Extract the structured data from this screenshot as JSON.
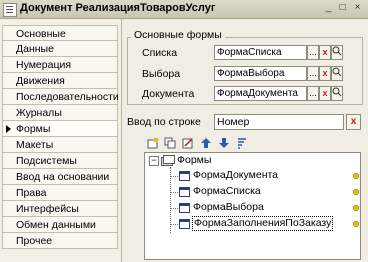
{
  "window": {
    "title": "Документ РеализацияТоваровУслуг"
  },
  "nav": {
    "items": [
      "Основные",
      "Данные",
      "Нумерация",
      "Движения",
      "Последовательности",
      "Журналы",
      "Формы",
      "Макеты",
      "Подсистемы",
      "Ввод на основании",
      "Права",
      "Интерфейсы",
      "Обмен данными",
      "Прочее"
    ],
    "active": "Формы"
  },
  "main_forms": {
    "title": "Основные формы",
    "rows": [
      {
        "label": "Списка",
        "value": "ФормаСписка"
      },
      {
        "label": "Выбора",
        "value": "ФормаВыбора"
      },
      {
        "label": "Документа",
        "value": "ФормаДокумента"
      }
    ]
  },
  "input_by_string": {
    "label": "Ввод по строке",
    "value": "Номер"
  },
  "tree": {
    "root": "Формы",
    "children": [
      "ФормаДокумента",
      "ФормаСписка",
      "ФормаВыбора",
      "ФормаЗаполненияПоЗаказу"
    ]
  },
  "symbols": {
    "ellipsis": "...",
    "clear": "x",
    "expand": "−"
  }
}
